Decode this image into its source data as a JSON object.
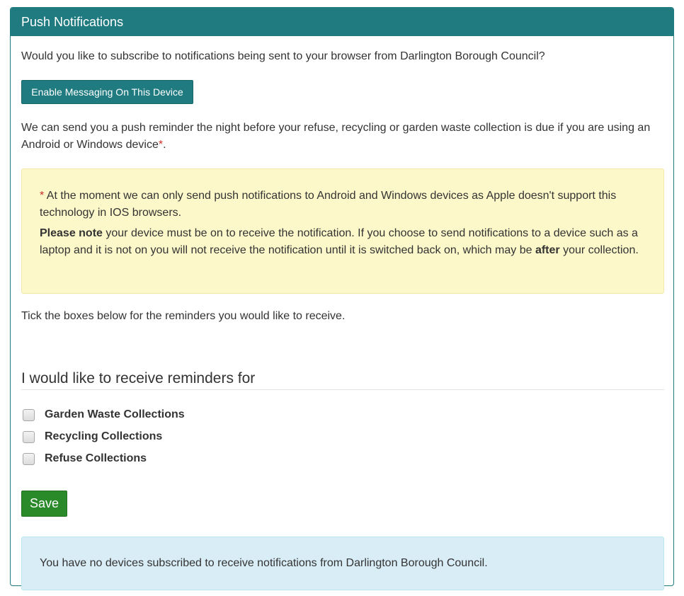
{
  "panel": {
    "title": "Push Notifications"
  },
  "intro": "Would you like to subscribe to notifications being sent to your browser from Darlington Borough Council?",
  "enable_button": "Enable Messaging On This Device",
  "reminder_text": "We can send you a push reminder the night before your refuse, recycling or garden waste collection is due if you are using an Android or Windows device",
  "asterisk": "*",
  "period": ".",
  "warning": {
    "asterisk": "*",
    "line1": " At the moment we can only send push notifications to Android and Windows devices as Apple doesn't support this technology in IOS browsers.",
    "note_bold": "Please note",
    "note_part1": " your device must be on to receive the notification. If you choose to send notifications to a device such as a laptop and it is not on you will not receive the notification until it is switched back on, which may be ",
    "note_after": "after",
    "note_part2": " your collection."
  },
  "tick_text": "Tick the boxes below for the reminders you would like to receive.",
  "legend": "I would like to receive reminders for",
  "checkboxes": [
    {
      "label": "Garden Waste Collections",
      "checked": false
    },
    {
      "label": "Recycling Collections",
      "checked": false
    },
    {
      "label": "Refuse Collections",
      "checked": false
    }
  ],
  "save_button": "Save",
  "info": "You have no devices subscribed to receive notifications from Darlington Borough Council.",
  "colors": {
    "header": "#1f7b80",
    "save": "#2a8a2a",
    "warning_bg": "#fcf8c9",
    "info_bg": "#d9edf7",
    "required": "#c9302c"
  }
}
